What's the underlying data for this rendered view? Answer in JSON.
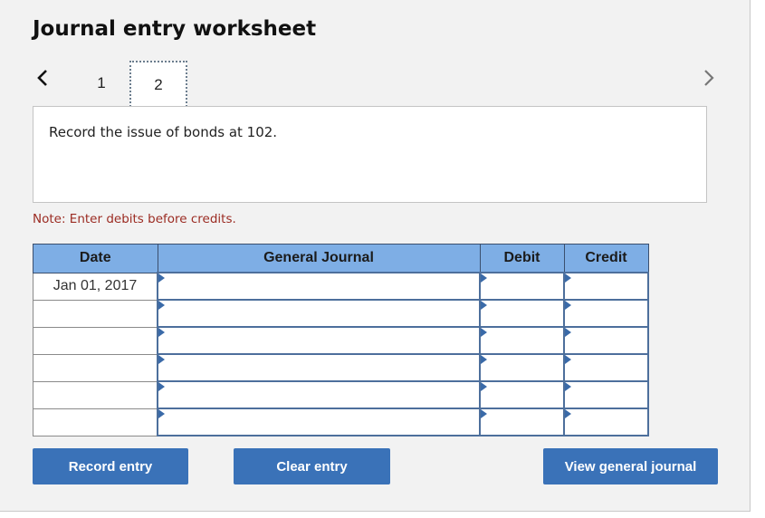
{
  "title": "Journal entry worksheet",
  "nav": {
    "prev_icon": "chevron-left-icon",
    "next_icon": "chevron-right-icon",
    "tabs": [
      {
        "label": "1",
        "active": false
      },
      {
        "label": "2",
        "active": true
      }
    ]
  },
  "description": "Record the issue of bonds at 102.",
  "note": "Note: Enter debits before credits.",
  "table": {
    "headers": [
      "Date",
      "General Journal",
      "Debit",
      "Credit"
    ],
    "rows": [
      {
        "date": "Jan 01, 2017",
        "account": "",
        "debit": "",
        "credit": ""
      },
      {
        "date": "",
        "account": "",
        "debit": "",
        "credit": ""
      },
      {
        "date": "",
        "account": "",
        "debit": "",
        "credit": ""
      },
      {
        "date": "",
        "account": "",
        "debit": "",
        "credit": ""
      },
      {
        "date": "",
        "account": "",
        "debit": "",
        "credit": ""
      },
      {
        "date": "",
        "account": "",
        "debit": "",
        "credit": ""
      }
    ]
  },
  "buttons": {
    "record": "Record entry",
    "clear": "Clear entry",
    "view": "View general journal"
  },
  "colors": {
    "header_bg": "#7eaee5",
    "button_bg": "#3a72b8",
    "note_text": "#9b2b22",
    "input_border": "#4d6f9c"
  }
}
